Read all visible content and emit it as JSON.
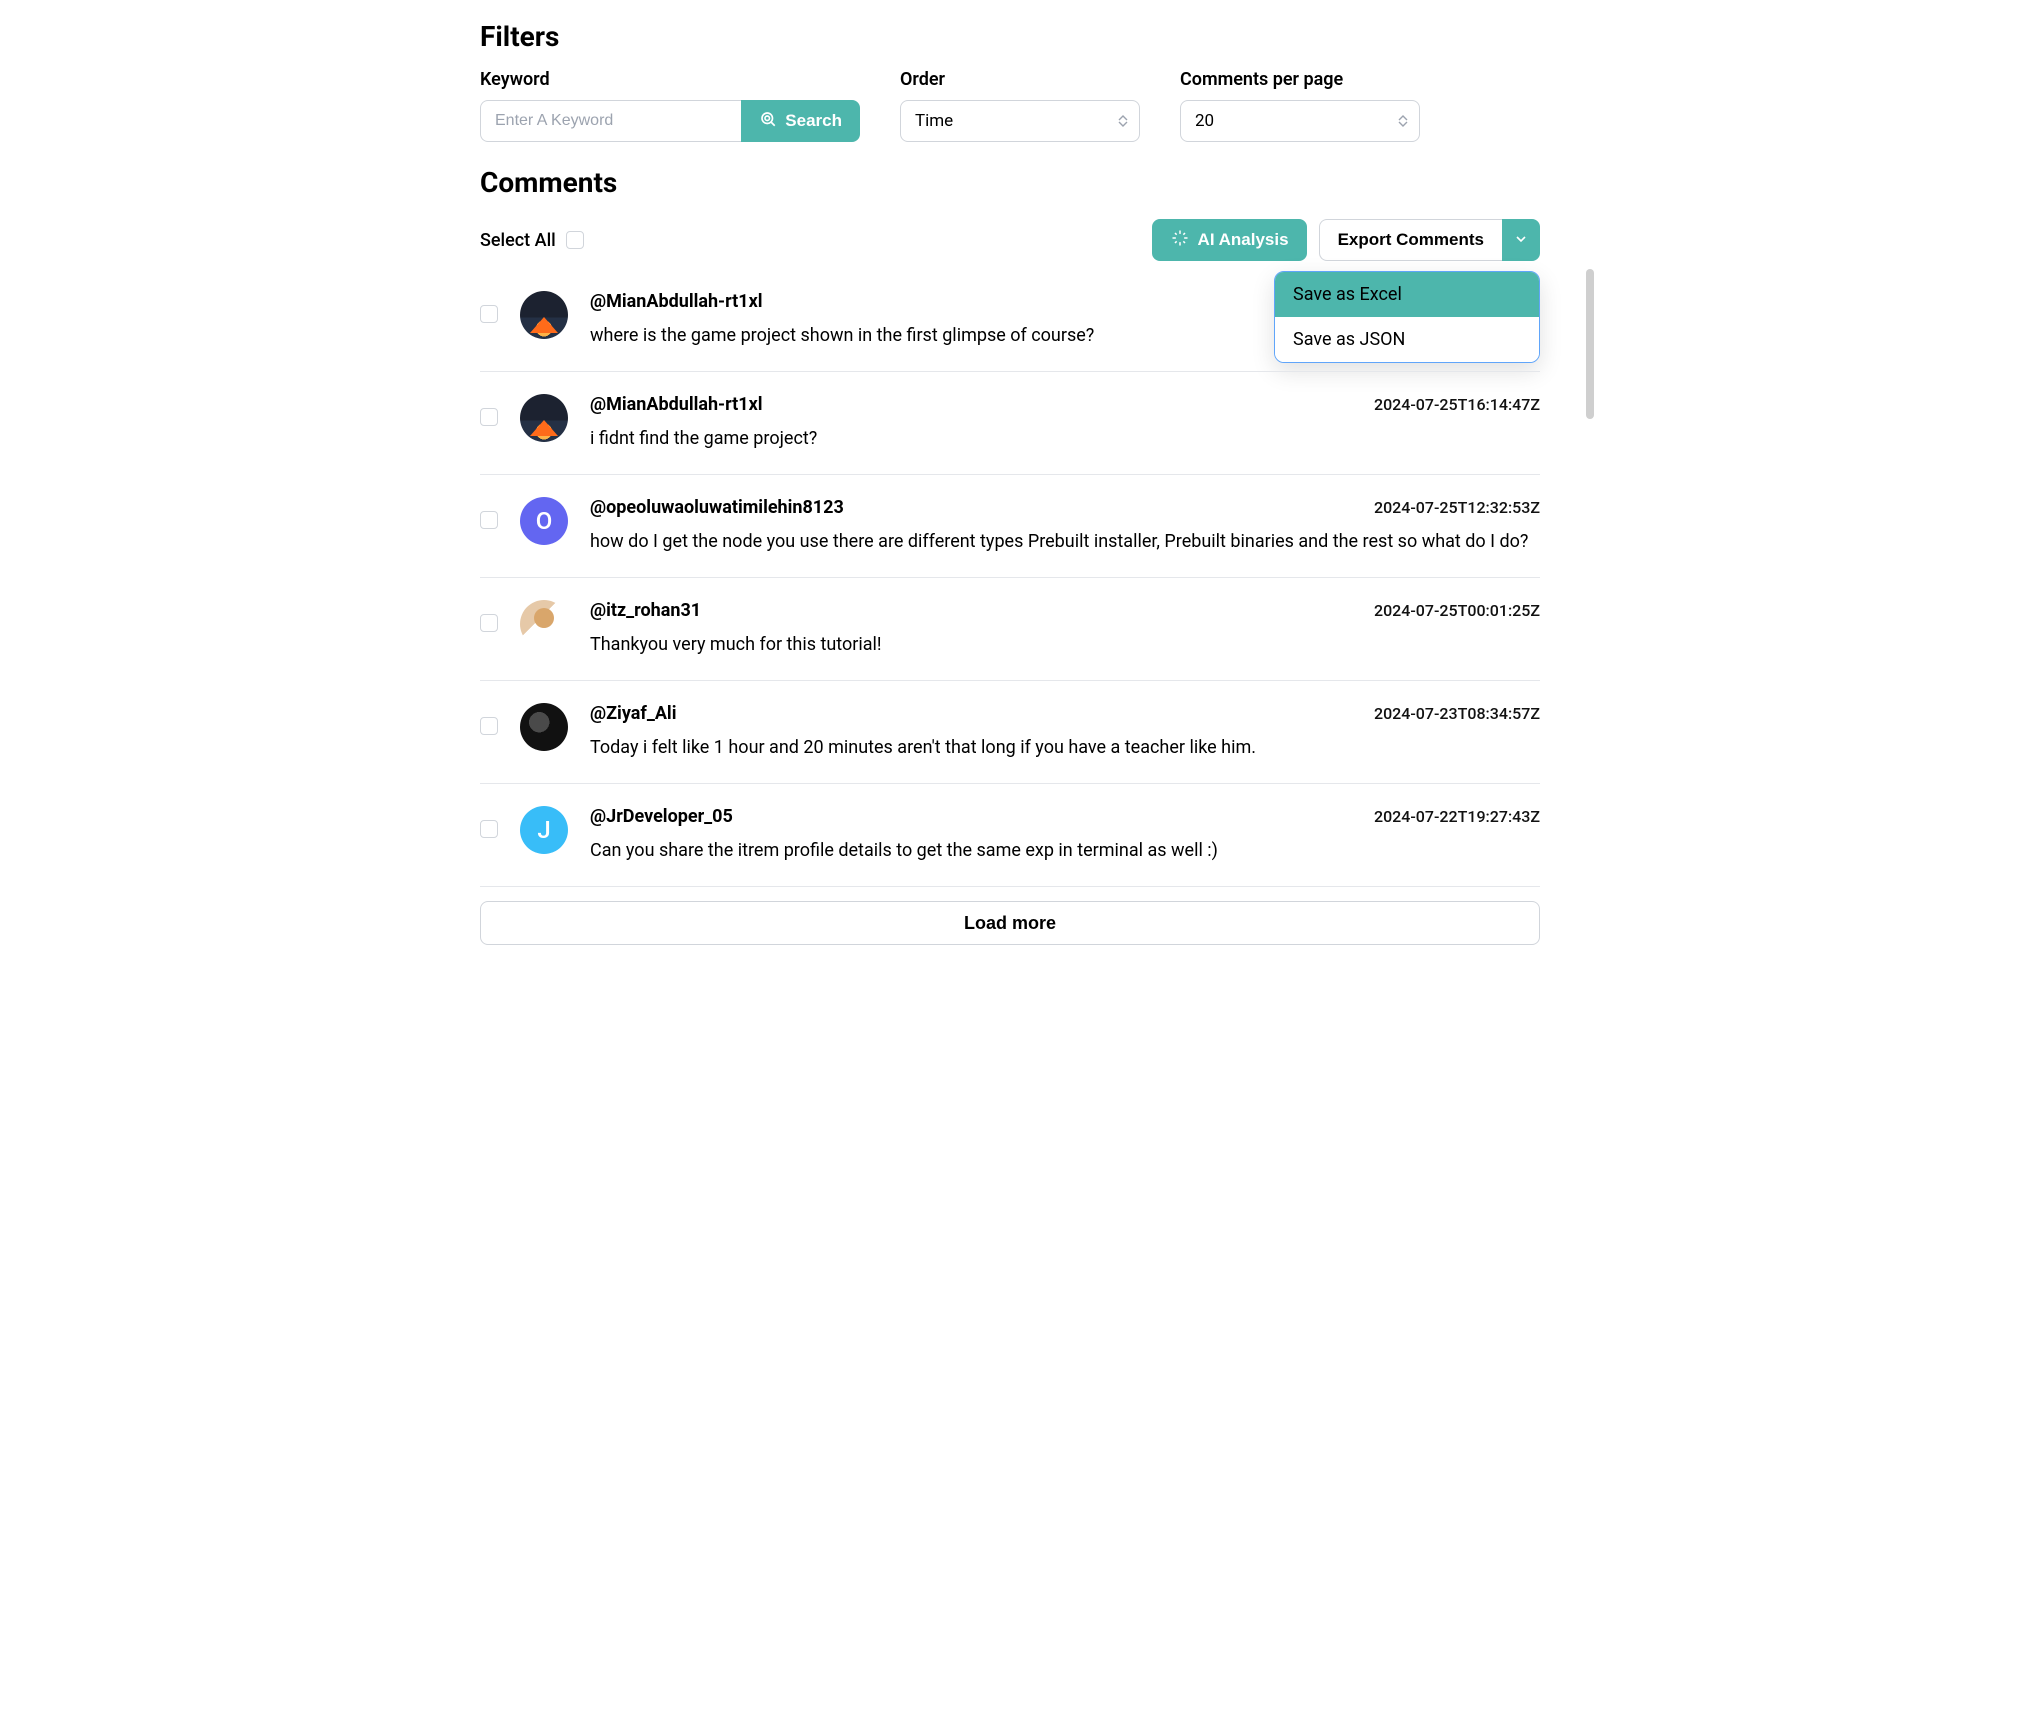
{
  "filters": {
    "title": "Filters",
    "keyword_label": "Keyword",
    "keyword_placeholder": "Enter A Keyword",
    "search_label": "Search",
    "order_label": "Order",
    "order_value": "Time",
    "per_page_label": "Comments per page",
    "per_page_value": "20"
  },
  "comments_section": {
    "title": "Comments",
    "select_all_label": "Select All",
    "ai_analysis_label": "AI Analysis",
    "export_label": "Export Comments",
    "dropdown": {
      "save_excel": "Save as Excel",
      "save_json": "Save as JSON"
    },
    "load_more_label": "Load more"
  },
  "comments": [
    {
      "username": "@MianAbdullah-rt1xl",
      "text": "where is the game project shown in the first glimpse of course?",
      "timestamp": "",
      "avatar_type": "camp",
      "avatar_letter": ""
    },
    {
      "username": "@MianAbdullah-rt1xl",
      "text": "i fidnt find the game project?",
      "timestamp": "2024-07-25T16:14:47Z",
      "avatar_type": "camp",
      "avatar_letter": ""
    },
    {
      "username": "@opeoluwaoluwatimilehin8123",
      "text": "how do I get the node you use there are different types Prebuilt installer, Prebuilt binaries and the rest so what do I do?",
      "timestamp": "2024-07-25T12:32:53Z",
      "avatar_type": "letter-o",
      "avatar_letter": "O"
    },
    {
      "username": "@itz_rohan31",
      "text": "Thankyou very much for this tutorial!",
      "timestamp": "2024-07-25T00:01:25Z",
      "avatar_type": "photo",
      "avatar_letter": ""
    },
    {
      "username": "@Ziyaf_Ali",
      "text": "Today i felt like 1 hour and 20 minutes aren't that long if you have a teacher like him.",
      "timestamp": "2024-07-23T08:34:57Z",
      "avatar_type": "dark",
      "avatar_letter": ""
    },
    {
      "username": "@JrDeveloper_05",
      "text": "Can you share the itrem profile details to get the same exp in terminal as well :)",
      "timestamp": "2024-07-22T19:27:43Z",
      "avatar_type": "letter-j",
      "avatar_letter": "J"
    }
  ],
  "colors": {
    "accent": "#4db6ac",
    "dropdown_border": "#60a5fa"
  }
}
